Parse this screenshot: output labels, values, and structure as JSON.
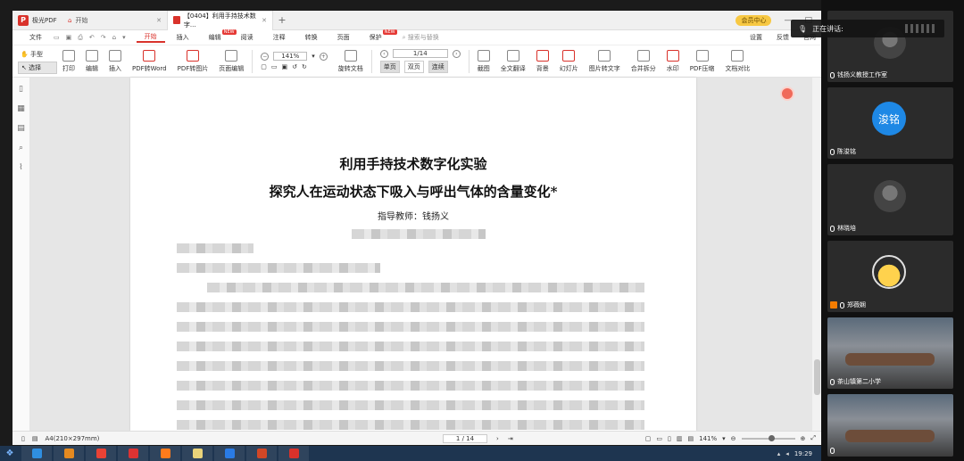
{
  "app": {
    "name": "极光PDF",
    "tabs": [
      {
        "label": "开始",
        "active": false
      },
      {
        "label": "【0404】利用手持技术数字...",
        "active": true
      }
    ],
    "new_tab": "+",
    "vip_label": "会员中心"
  },
  "menubar": {
    "file_label": "文件",
    "items": [
      "开始",
      "插入",
      "编辑",
      "阅读",
      "注释",
      "转换",
      "页面",
      "保护"
    ],
    "new_badge": "NEW",
    "search_placeholder": "搜索与替换",
    "right": [
      "设置",
      "反馈",
      "官网"
    ]
  },
  "toolbar": {
    "hand_label": "手型",
    "select_label": "选择",
    "tools_left": [
      "打印",
      "编辑",
      "插入",
      "PDF转Word",
      "PDF转图片",
      "页面编辑"
    ],
    "zoom_value": "141%",
    "page_value": "1/14",
    "rotate_label": "旋转文档",
    "view_single": "单页",
    "view_double": "双页",
    "view_continuous": "连续",
    "tools_right": [
      "截图",
      "全文翻译",
      "背景",
      "幻灯片",
      "图片转文字",
      "合并拆分",
      "水印",
      "PDF压缩",
      "文档对比"
    ]
  },
  "document": {
    "title": "利用手持技术数字化实验",
    "subtitle": "探究人在运动状态下吸入与呼出气体的含量变化*",
    "advisor": "指导教师：钱扬义"
  },
  "statusbar": {
    "page_size": "A4(210×297mm)",
    "page_indicator": "1 / 14",
    "zoom": "141%"
  },
  "taskbar": {
    "time": "19:29"
  },
  "meeting": {
    "speaking_label": "正在讲话:",
    "participants": [
      {
        "name": "钱扬义教授工作室"
      },
      {
        "name": "陈浚铭",
        "avatar_text": "浚铭"
      },
      {
        "name": "林晓培"
      },
      {
        "name": "郑薇娴"
      },
      {
        "name": "茶山镇第二小学"
      },
      {
        "name": ""
      }
    ]
  }
}
